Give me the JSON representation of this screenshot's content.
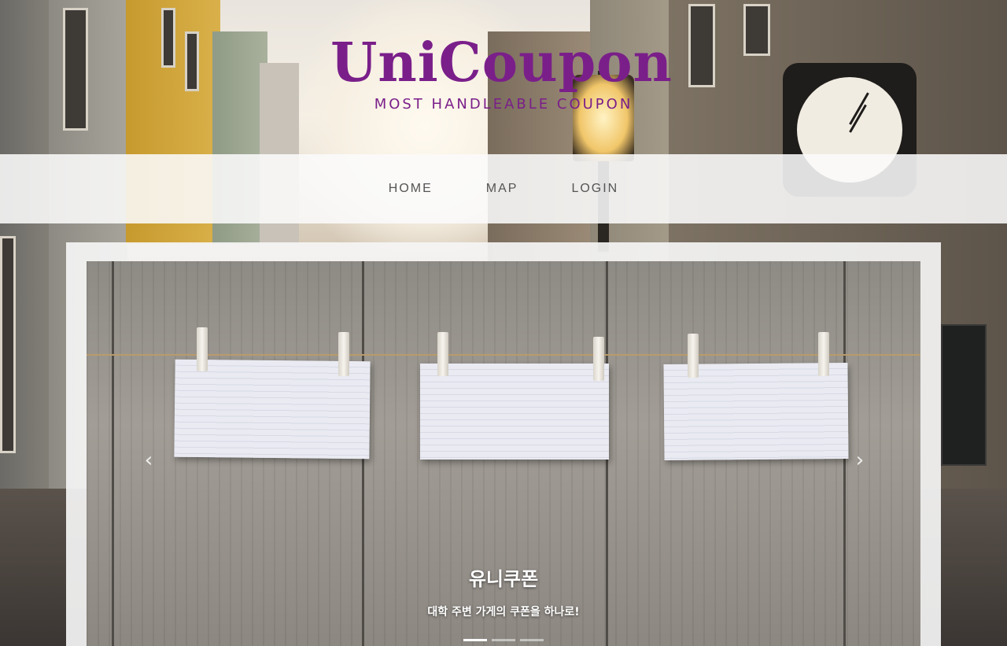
{
  "brand": {
    "title": "UniCoupon",
    "subtitle": "MOST HANDLEABLE COUPON",
    "color": "#7a1f8a"
  },
  "nav": {
    "items": [
      {
        "label": "HOME"
      },
      {
        "label": "MAP"
      },
      {
        "label": "LOGIN"
      }
    ]
  },
  "carousel": {
    "caption_title": "유니쿠폰",
    "caption_text": "대학 주변 가게의 쿠폰을 하나로!",
    "prev_icon": "chevron-left-icon",
    "next_icon": "chevron-right-icon",
    "prev_glyph": "‹",
    "next_glyph": "›",
    "slide_count": 3,
    "active_slide": 1
  }
}
